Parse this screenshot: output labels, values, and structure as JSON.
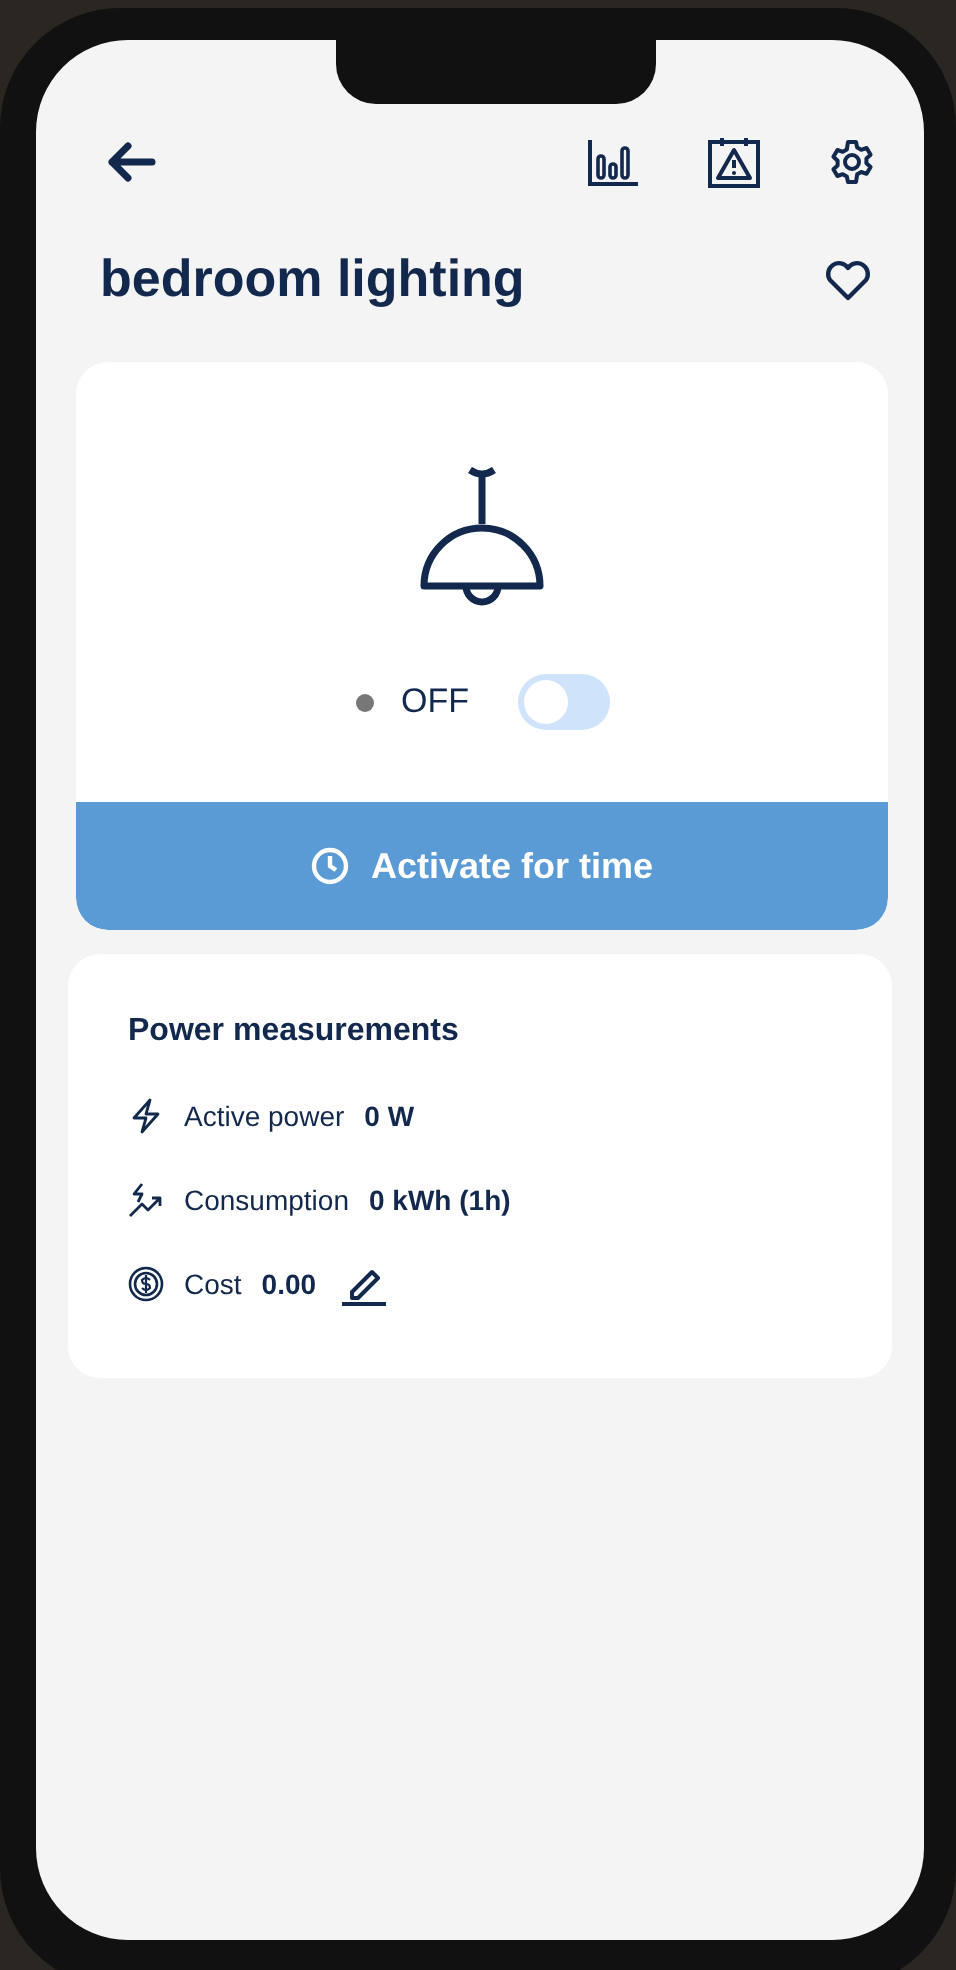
{
  "header": {
    "title": "bedroom lighting",
    "favorite": false
  },
  "device": {
    "state_label": "OFF",
    "on": false
  },
  "action_button": {
    "label": "Activate for time"
  },
  "measurements": {
    "title": "Power measurements",
    "items": [
      {
        "kind": "power",
        "label": "Active power",
        "value": "0 W"
      },
      {
        "kind": "consumption",
        "label": "Consumption",
        "value": "0 kWh (1h)"
      },
      {
        "kind": "cost",
        "label": "Cost",
        "value": "0.00"
      }
    ]
  }
}
